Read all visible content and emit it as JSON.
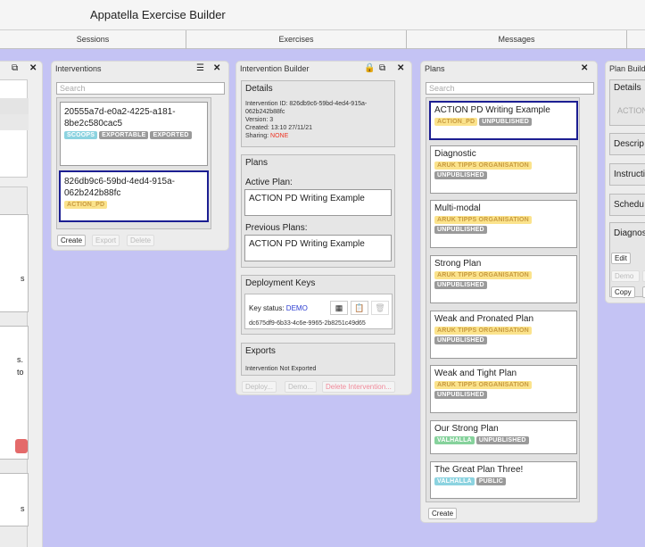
{
  "app": {
    "title": "Appatella Exercise Builder"
  },
  "nav": {
    "tabs": [
      "Sessions",
      "Exercises",
      "Messages"
    ]
  },
  "interventions": {
    "title": "Interventions",
    "search_placeholder": "Search",
    "items": [
      {
        "id": "20555a7d-e0a2-4225-a181-8be2c580cac5",
        "badges": [
          "SCOOPS",
          "EXPORTABLE",
          "EXPORTED"
        ]
      },
      {
        "id": "826db9c6-59bd-4ed4-915a-062b242b88fc",
        "badges": [
          "ACTION_PD"
        ]
      }
    ],
    "buttons": {
      "create": "Create",
      "export": "Export",
      "delete": "Delete"
    }
  },
  "builder": {
    "title": "Intervention Builder",
    "details": {
      "title": "Details",
      "id_line": "Intervention ID: 826db9c6-59bd-4ed4-915a-062b242b88fc",
      "version": "Version: 3",
      "created": "Created: 13:10 27/11/21",
      "sharing_label": "Sharing: ",
      "sharing_value": "NONE"
    },
    "plans": {
      "title": "Plans",
      "active_label": "Active Plan:",
      "active_value": "ACTION PD Writing Example",
      "previous_label": "Previous Plans:",
      "previous_value": "ACTION PD Writing Example"
    },
    "keys": {
      "title": "Deployment Keys",
      "status_label": "Key status: ",
      "status_value": "DEMO",
      "key": "dc675df9-6b33-4c6e-9965-2b8251c49d65"
    },
    "exports": {
      "title": "Exports",
      "status": "Intervention Not Exported"
    },
    "buttons": {
      "deploy": "Deploy...",
      "demo": "Demo...",
      "delete": "Delete Intervention..."
    }
  },
  "plans": {
    "title": "Plans",
    "search_placeholder": "Search",
    "items": [
      {
        "name": "ACTION PD Writing Example",
        "badges": [
          "ACTION_PD",
          "UNPUBLISHED"
        ]
      },
      {
        "name": "Diagnostic",
        "badges": [
          "ARUK TIPPS ORGANISATION",
          "UNPUBLISHED"
        ]
      },
      {
        "name": "Multi-modal",
        "badges": [
          "ARUK TIPPS ORGANISATION",
          "UNPUBLISHED"
        ]
      },
      {
        "name": "Strong Plan",
        "badges": [
          "ARUK TIPPS ORGANISATION",
          "UNPUBLISHED"
        ]
      },
      {
        "name": "Weak and Pronated Plan",
        "badges": [
          "ARUK TIPPS ORGANISATION",
          "UNPUBLISHED"
        ]
      },
      {
        "name": "Weak and Tight Plan",
        "badges": [
          "ARUK TIPPS ORGANISATION",
          "UNPUBLISHED"
        ]
      },
      {
        "name": "Our Strong Plan",
        "badges": [
          "VALHALLA",
          "UNPUBLISHED"
        ]
      },
      {
        "name": "The Great Plan Three!",
        "badges": [
          "VALHALLA",
          "PUBLIC"
        ]
      }
    ],
    "create": "Create"
  },
  "plan_builder": {
    "title": "Plan Build",
    "sections": [
      "Details",
      "Descrip",
      "Instructi",
      "Schedu",
      "Diagnos"
    ],
    "details_value": "ACTION",
    "buttons": {
      "edit": "Edit",
      "demo": "Demo",
      "copy": "Copy"
    }
  },
  "left_partial": {
    "text1": "s",
    "text2": "s.",
    "text3": "to",
    "text4": "s"
  },
  "colors": {
    "background": "#c4c3f4",
    "accent": "#1c1e92",
    "danger": "#e32"
  }
}
